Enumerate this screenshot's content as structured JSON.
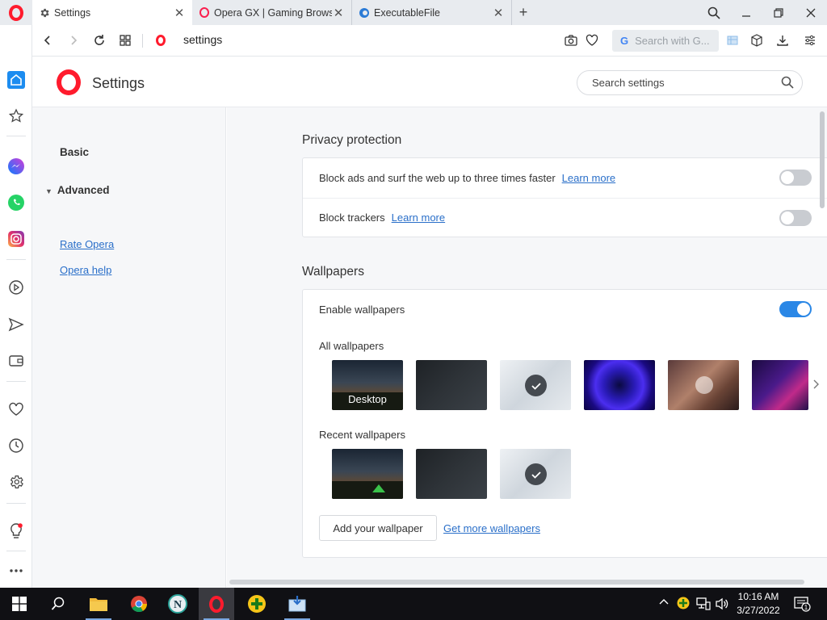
{
  "tabs": [
    {
      "title": "Settings",
      "active": true
    },
    {
      "title": "Opera GX | Gaming Browse",
      "active": false
    },
    {
      "title": "ExecutableFile",
      "active": false
    }
  ],
  "address": {
    "url": "settings",
    "search_placeholder": "Search with G..."
  },
  "settings": {
    "title": "Settings",
    "search_placeholder": "Search settings",
    "nav": {
      "basic": "Basic",
      "advanced": "Advanced",
      "rate": "Rate Opera",
      "help": "Opera help"
    }
  },
  "privacy": {
    "title": "Privacy protection",
    "block_ads": {
      "label": "Block ads and surf the web up to three times faster",
      "link": "Learn more",
      "enabled": false
    },
    "block_trackers": {
      "label": "Block trackers",
      "link": "Learn more",
      "enabled": false
    }
  },
  "wallpapers": {
    "title": "Wallpapers",
    "enable_label": "Enable wallpapers",
    "enabled": true,
    "all_label": "All wallpapers",
    "recent_label": "Recent wallpapers",
    "desktop_caption": "Desktop",
    "add_button": "Add your wallpaper",
    "more_link": "Get more wallpapers"
  },
  "taskbar": {
    "time": "10:16 AM",
    "date": "3/27/2022",
    "notifications": "1"
  },
  "colors": {
    "opera_red": "#ff1b2d",
    "accent": "#2a87e6",
    "link": "#2a6fc9"
  }
}
